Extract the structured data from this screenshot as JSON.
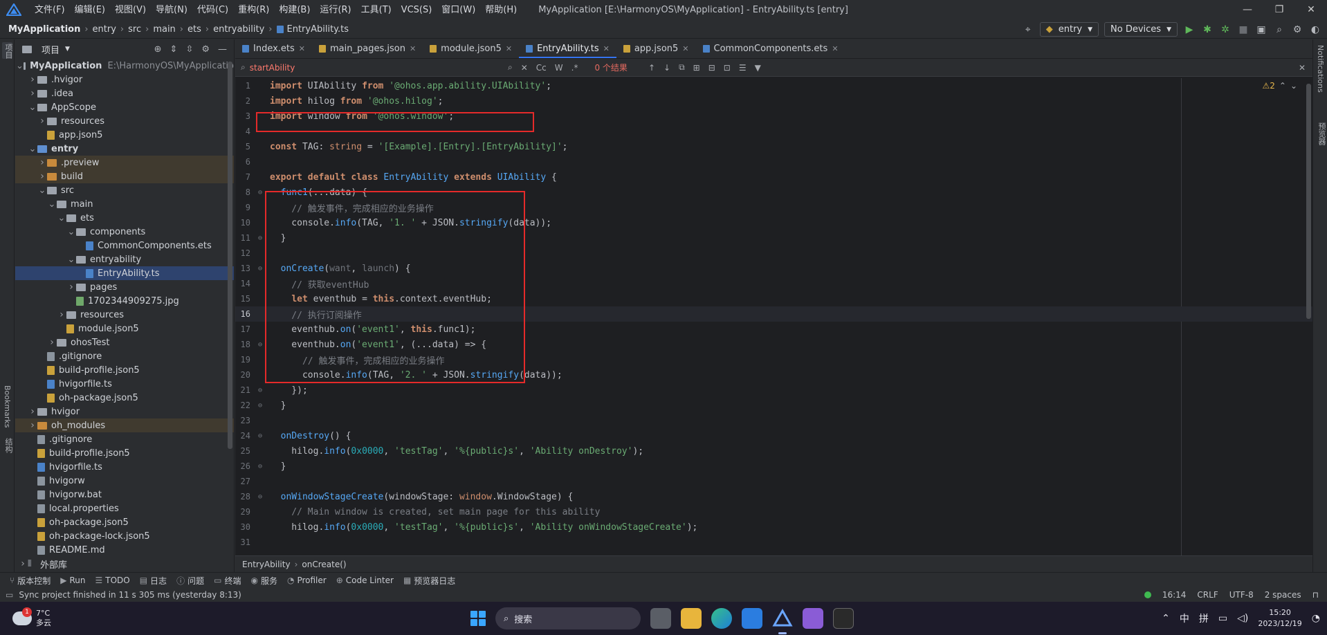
{
  "app": {
    "menu": [
      "文件(F)",
      "编辑(E)",
      "视图(V)",
      "导航(N)",
      "代码(C)",
      "重构(R)",
      "构建(B)",
      "运行(R)",
      "工具(T)",
      "VCS(S)",
      "窗口(W)",
      "帮助(H)"
    ],
    "window_title": "MyApplication [E:\\HarmonyOS\\MyApplication] - EntryAbility.ts [entry]",
    "controls": {
      "minimize": "—",
      "restore": "❐",
      "close": "✕"
    }
  },
  "breadcrumb": [
    "MyApplication",
    "entry",
    "src",
    "main",
    "ets",
    "entryability",
    "EntryAbility.ts"
  ],
  "toolbar_right": {
    "module": "entry",
    "device": "No Devices"
  },
  "left_strip": {
    "project": "项目",
    "bookmarks": "Bookmarks",
    "structure": "结构"
  },
  "right_strip": {
    "notifications": "Notifications",
    "preview": "预览器"
  },
  "project_panel": {
    "title": "项目",
    "items": [
      {
        "label": "MyApplication",
        "extra": "E:\\HarmonyOS\\MyApplicatio",
        "depth": 0,
        "arrow": "open",
        "kind": "folder",
        "bold": true
      },
      {
        "label": ".hvigor",
        "depth": 1,
        "arrow": "closed",
        "kind": "folder"
      },
      {
        "label": ".idea",
        "depth": 1,
        "arrow": "closed",
        "kind": "folder"
      },
      {
        "label": "AppScope",
        "depth": 1,
        "arrow": "open",
        "kind": "folder"
      },
      {
        "label": "resources",
        "depth": 2,
        "arrow": "closed",
        "kind": "folder"
      },
      {
        "label": "app.json5",
        "depth": 2,
        "arrow": "none",
        "kind": "json"
      },
      {
        "label": "entry",
        "depth": 1,
        "arrow": "open",
        "kind": "folder-blue",
        "bold": true
      },
      {
        "label": ".preview",
        "depth": 2,
        "arrow": "closed",
        "kind": "folder-orange",
        "excluded": true
      },
      {
        "label": "build",
        "depth": 2,
        "arrow": "closed",
        "kind": "folder-orange",
        "excluded": true
      },
      {
        "label": "src",
        "depth": 2,
        "arrow": "open",
        "kind": "folder"
      },
      {
        "label": "main",
        "depth": 3,
        "arrow": "open",
        "kind": "folder"
      },
      {
        "label": "ets",
        "depth": 4,
        "arrow": "open",
        "kind": "folder"
      },
      {
        "label": "components",
        "depth": 5,
        "arrow": "open",
        "kind": "folder"
      },
      {
        "label": "CommonComponents.ets",
        "depth": 6,
        "arrow": "none",
        "kind": "ts"
      },
      {
        "label": "entryability",
        "depth": 5,
        "arrow": "open",
        "kind": "folder"
      },
      {
        "label": "EntryAbility.ts",
        "depth": 6,
        "arrow": "none",
        "kind": "ts",
        "selected": true
      },
      {
        "label": "pages",
        "depth": 5,
        "arrow": "closed",
        "kind": "folder"
      },
      {
        "label": "1702344909275.jpg",
        "depth": 5,
        "arrow": "none",
        "kind": "img"
      },
      {
        "label": "resources",
        "depth": 4,
        "arrow": "closed",
        "kind": "folder"
      },
      {
        "label": "module.json5",
        "depth": 4,
        "arrow": "none",
        "kind": "json"
      },
      {
        "label": "ohosTest",
        "depth": 3,
        "arrow": "closed",
        "kind": "folder"
      },
      {
        "label": ".gitignore",
        "depth": 2,
        "arrow": "none",
        "kind": "file"
      },
      {
        "label": "build-profile.json5",
        "depth": 2,
        "arrow": "none",
        "kind": "json"
      },
      {
        "label": "hvigorfile.ts",
        "depth": 2,
        "arrow": "none",
        "kind": "ts"
      },
      {
        "label": "oh-package.json5",
        "depth": 2,
        "arrow": "none",
        "kind": "json"
      },
      {
        "label": "hvigor",
        "depth": 1,
        "arrow": "closed",
        "kind": "folder"
      },
      {
        "label": "oh_modules",
        "depth": 1,
        "arrow": "closed",
        "kind": "folder-orange",
        "excluded": true
      },
      {
        "label": ".gitignore",
        "depth": 1,
        "arrow": "none",
        "kind": "file"
      },
      {
        "label": "build-profile.json5",
        "depth": 1,
        "arrow": "none",
        "kind": "json"
      },
      {
        "label": "hvigorfile.ts",
        "depth": 1,
        "arrow": "none",
        "kind": "ts"
      },
      {
        "label": "hvigorw",
        "depth": 1,
        "arrow": "none",
        "kind": "file"
      },
      {
        "label": "hvigorw.bat",
        "depth": 1,
        "arrow": "none",
        "kind": "file"
      },
      {
        "label": "local.properties",
        "depth": 1,
        "arrow": "none",
        "kind": "file"
      },
      {
        "label": "oh-package.json5",
        "depth": 1,
        "arrow": "none",
        "kind": "json"
      },
      {
        "label": "oh-package-lock.json5",
        "depth": 1,
        "arrow": "none",
        "kind": "json"
      },
      {
        "label": "README.md",
        "depth": 1,
        "arrow": "none",
        "kind": "file"
      },
      {
        "label": "外部库",
        "depth": 0,
        "arrow": "closed",
        "kind": "lib"
      }
    ]
  },
  "tabs": [
    {
      "label": "Index.ets",
      "color": "#4a82c8"
    },
    {
      "label": "main_pages.json",
      "color": "#c9a13b"
    },
    {
      "label": "module.json5",
      "color": "#c9a13b"
    },
    {
      "label": "EntryAbility.ts",
      "color": "#4a82c8",
      "active": true
    },
    {
      "label": "app.json5",
      "color": "#c9a13b"
    },
    {
      "label": "CommonComponents.ets",
      "color": "#4a82c8"
    }
  ],
  "find": {
    "query": "startAbility",
    "opts": [
      "Cc",
      "W",
      ".*"
    ],
    "result": "0 个结果"
  },
  "inspection": "⚠2",
  "code_lines": [
    [
      [
        "kwb",
        "import "
      ],
      [
        "txt",
        "UIAbility "
      ],
      [
        "kwb",
        "from "
      ],
      [
        "str",
        "'@ohos.app.ability.UIAbility'"
      ],
      [
        "txt",
        ";"
      ]
    ],
    [
      [
        "kwb",
        "import "
      ],
      [
        "txt",
        "hilog "
      ],
      [
        "kwb",
        "from "
      ],
      [
        "str",
        "'@ohos.hilog'"
      ],
      [
        "txt",
        ";"
      ]
    ],
    [
      [
        "kwb",
        "import "
      ],
      [
        "txt",
        "window "
      ],
      [
        "kwb",
        "from "
      ],
      [
        "str",
        "'@ohos.window'"
      ],
      [
        "txt",
        ";"
      ]
    ],
    [],
    [
      [
        "kwb",
        "const "
      ],
      [
        "txt",
        "TAG: "
      ],
      [
        "tp",
        "string"
      ],
      [
        "txt",
        " = "
      ],
      [
        "str",
        "'[Example].[Entry].[EntryAbility]'"
      ],
      [
        "txt",
        ";"
      ]
    ],
    [],
    [
      [
        "kwb",
        "export default class "
      ],
      [
        "cls",
        "EntryAbility "
      ],
      [
        "kwb",
        "extends "
      ],
      [
        "cls",
        "UIAbility "
      ],
      [
        "txt",
        "{"
      ]
    ],
    [
      [
        "txt",
        "  "
      ],
      [
        "fn",
        "func1"
      ],
      [
        "txt",
        "(...data) {"
      ]
    ],
    [
      [
        "cm",
        "    // 触发事件，完成相应的业务操作"
      ]
    ],
    [
      [
        "txt",
        "    console."
      ],
      [
        "fn",
        "info"
      ],
      [
        "txt",
        "(TAG, "
      ],
      [
        "str",
        "'1. '"
      ],
      [
        "txt",
        " + JSON."
      ],
      [
        "fn",
        "stringify"
      ],
      [
        "txt",
        "(data));"
      ]
    ],
    [
      [
        "txt",
        "  }"
      ]
    ],
    [],
    [
      [
        "txt",
        "  "
      ],
      [
        "fn",
        "onCreate"
      ],
      [
        "txt",
        "("
      ],
      [
        "prm",
        "want"
      ],
      [
        "txt",
        ", "
      ],
      [
        "prm",
        "launch"
      ],
      [
        "txt",
        ") {"
      ]
    ],
    [
      [
        "cm",
        "    // 获取eventHub"
      ]
    ],
    [
      [
        "txt",
        "    "
      ],
      [
        "kwb",
        "let "
      ],
      [
        "txt",
        "eventhub = "
      ],
      [
        "kwb",
        "this"
      ],
      [
        "txt",
        ".context.eventHub;"
      ]
    ],
    [
      [
        "cm",
        "    // 执行订阅操作"
      ]
    ],
    [
      [
        "txt",
        "    eventhub."
      ],
      [
        "fn",
        "on"
      ],
      [
        "txt",
        "("
      ],
      [
        "str",
        "'event1'"
      ],
      [
        "txt",
        ", "
      ],
      [
        "kwb",
        "this"
      ],
      [
        "txt",
        ".func1);"
      ]
    ],
    [
      [
        "txt",
        "    eventhub."
      ],
      [
        "fn",
        "on"
      ],
      [
        "txt",
        "("
      ],
      [
        "str",
        "'event1'"
      ],
      [
        "txt",
        ", (...data) => {"
      ]
    ],
    [
      [
        "cm",
        "      // 触发事件，完成相应的业务操作"
      ]
    ],
    [
      [
        "txt",
        "      console."
      ],
      [
        "fn",
        "info"
      ],
      [
        "txt",
        "(TAG, "
      ],
      [
        "str",
        "'2. '"
      ],
      [
        "txt",
        " + JSON."
      ],
      [
        "fn",
        "stringify"
      ],
      [
        "txt",
        "(data));"
      ]
    ],
    [
      [
        "txt",
        "    });"
      ]
    ],
    [
      [
        "txt",
        "  }"
      ]
    ],
    [],
    [
      [
        "txt",
        "  "
      ],
      [
        "fn",
        "onDestroy"
      ],
      [
        "txt",
        "() {"
      ]
    ],
    [
      [
        "txt",
        "    hilog."
      ],
      [
        "fn",
        "info"
      ],
      [
        "txt",
        "("
      ],
      [
        "num16",
        "0x0000"
      ],
      [
        "txt",
        ", "
      ],
      [
        "str",
        "'testTag'"
      ],
      [
        "txt",
        ", "
      ],
      [
        "str",
        "'%{public}s'"
      ],
      [
        "txt",
        ", "
      ],
      [
        "str",
        "'Ability onDestroy'"
      ],
      [
        "txt",
        ");"
      ]
    ],
    [
      [
        "txt",
        "  }"
      ]
    ],
    [],
    [
      [
        "txt",
        "  "
      ],
      [
        "fn",
        "onWindowStageCreate"
      ],
      [
        "txt",
        "(windowStage: "
      ],
      [
        "tp",
        "window"
      ],
      [
        "txt",
        ".WindowStage) {"
      ]
    ],
    [
      [
        "cm",
        "    // Main window is created, set main page for this ability"
      ]
    ],
    [
      [
        "txt",
        "    hilog."
      ],
      [
        "fn",
        "info"
      ],
      [
        "txt",
        "("
      ],
      [
        "num16",
        "0x0000"
      ],
      [
        "txt",
        ", "
      ],
      [
        "str",
        "'testTag'"
      ],
      [
        "txt",
        ", "
      ],
      [
        "str",
        "'%{public}s'"
      ],
      [
        "txt",
        ", "
      ],
      [
        "str",
        "'Ability onWindowStageCreate'"
      ],
      [
        "txt",
        ");"
      ]
    ],
    []
  ],
  "current_line": 16,
  "status_crumb": [
    "EntryAbility",
    "onCreate()"
  ],
  "tool_windows": [
    {
      "icon": "⑂",
      "label": "版本控制"
    },
    {
      "icon": "▶",
      "label": "Run"
    },
    {
      "icon": "☰",
      "label": "TODO"
    },
    {
      "icon": "▤",
      "label": "日志"
    },
    {
      "icon": "ⓘ",
      "label": "问题"
    },
    {
      "icon": "▭",
      "label": "终端"
    },
    {
      "icon": "◉",
      "label": "服务"
    },
    {
      "icon": "◔",
      "label": "Profiler"
    },
    {
      "icon": "⊕",
      "label": "Code Linter"
    },
    {
      "icon": "▦",
      "label": "预览器日志"
    }
  ],
  "status": {
    "message": "Sync project finished in 11 s 305 ms (yesterday 8:13)",
    "position": "16:14",
    "eol": "CRLF",
    "encoding": "UTF-8",
    "indent": "2 spaces"
  },
  "taskbar": {
    "temp": "7°C",
    "weather": "多云",
    "badge": "1",
    "search": "搜索",
    "ime1": "中",
    "ime2": "拼",
    "time": "15:20",
    "date": "2023/12/19"
  }
}
